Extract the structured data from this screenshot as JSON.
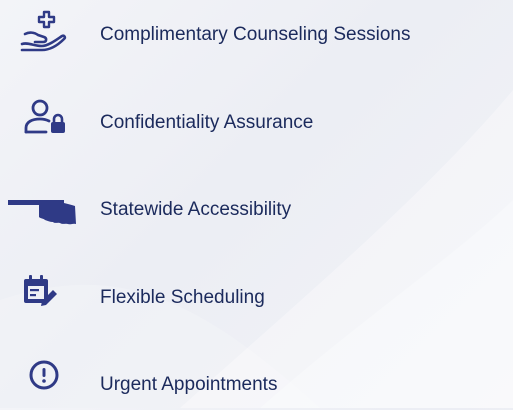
{
  "colors": {
    "icon": "#2f3a86",
    "text": "#1b2a5c",
    "background": "#eef0f5"
  },
  "features": [
    {
      "label": "Complimentary Counseling Sessions",
      "icon": "hand-medical-cross-icon"
    },
    {
      "label": "Confidentiality Assurance",
      "icon": "user-lock-icon"
    },
    {
      "label": "Statewide Accessibility",
      "icon": "oklahoma-state-icon"
    },
    {
      "label": "Flexible Scheduling",
      "icon": "calendar-edit-icon"
    },
    {
      "label": "Urgent Appointments",
      "icon": "exclamation-circle-icon"
    }
  ]
}
